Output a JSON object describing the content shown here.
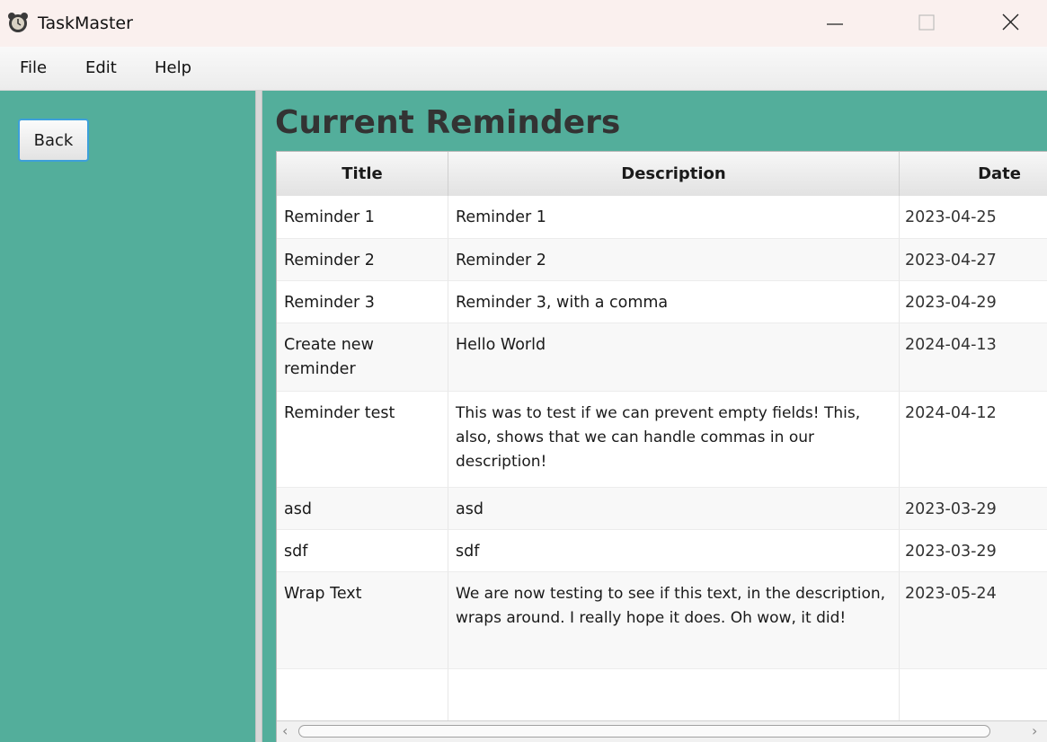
{
  "window": {
    "title": "TaskMaster",
    "icon": "alarm-clock-icon",
    "controls": [
      "minimize-icon",
      "maximize-icon",
      "close-icon"
    ]
  },
  "menu": [
    "File",
    "Edit",
    "Help"
  ],
  "sidebar": {
    "back_label": "Back"
  },
  "main": {
    "title": "Current Reminders",
    "columns": [
      "Title",
      "Description",
      "Date"
    ],
    "rows": [
      {
        "title": "Reminder 1",
        "description": "Reminder 1",
        "date": "2023-04-25"
      },
      {
        "title": "Reminder 2",
        "description": "Reminder 2",
        "date": "2023-04-27"
      },
      {
        "title": "Reminder 3",
        "description": "Reminder 3, with a comma",
        "date": "2023-04-29"
      },
      {
        "title": "Create new reminder",
        "description": "Hello World",
        "date": "2024-04-13"
      },
      {
        "title": "Reminder test",
        "description": "This was to test if we can prevent empty fields! This, also, shows that we can handle commas in our description!",
        "date": "2024-04-12"
      },
      {
        "title": "asd",
        "description": "asd",
        "date": "2023-03-29"
      },
      {
        "title": "sdf",
        "description": "sdf",
        "date": "2023-03-29"
      },
      {
        "title": "Wrap Text",
        "description": "We are now testing to see if this text, in the description, wraps around. I really hope it does. Oh wow, it did!",
        "date": "2023-05-24"
      },
      {
        "title": "",
        "description": "",
        "date": ""
      }
    ]
  },
  "colors": {
    "background": "#53ae9b",
    "titlebar": "#faf0ee",
    "row_alt": "#f8f8f8",
    "focus": "#3d9fda"
  }
}
